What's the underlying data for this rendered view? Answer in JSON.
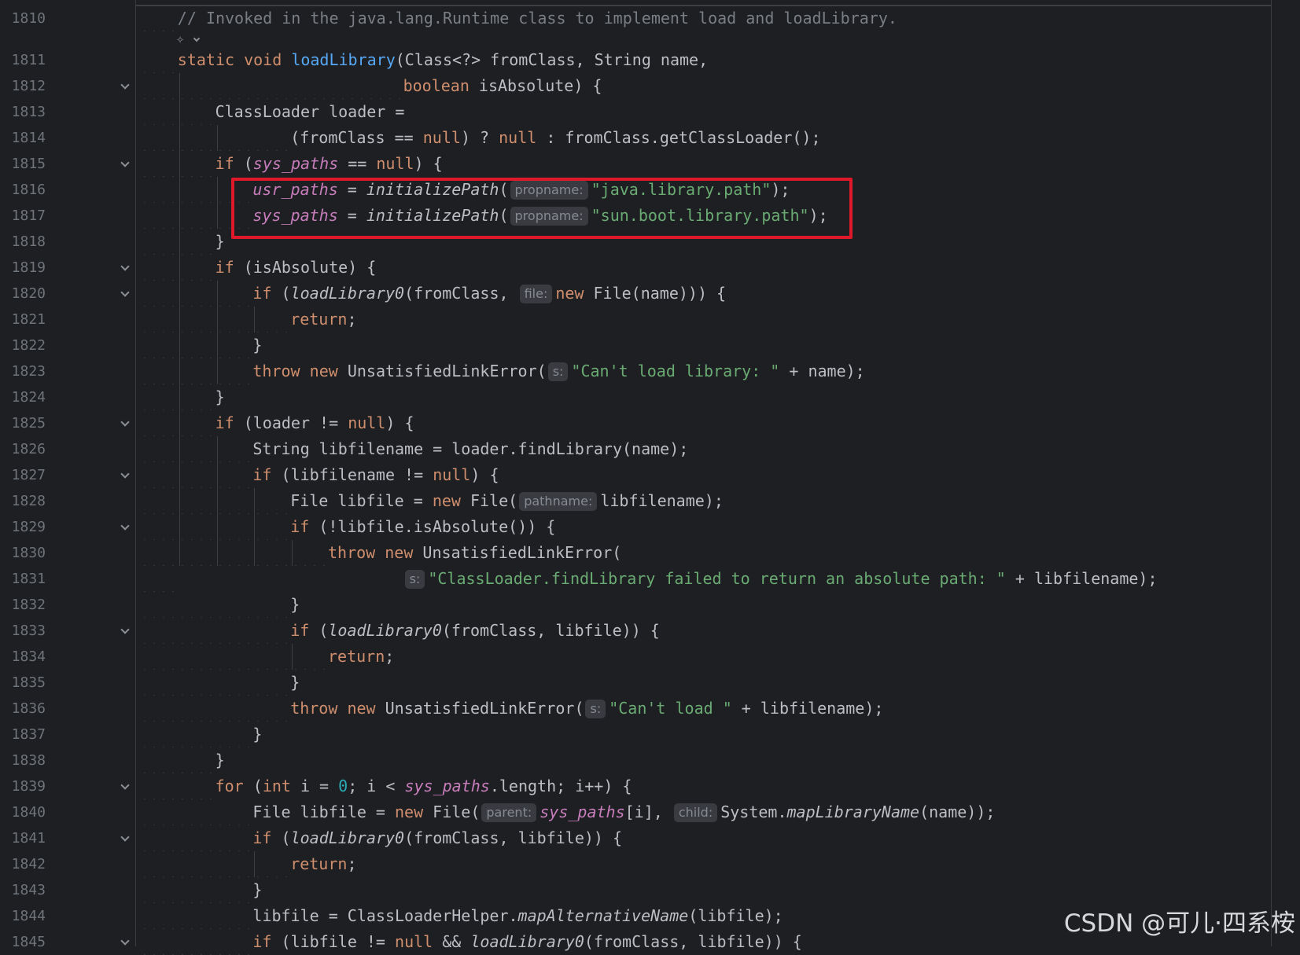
{
  "editor": {
    "ai_hint_icon": "ai-assistant-icon",
    "watermark": "CSDN @可儿·四系桉",
    "lines": [
      {
        "num": "1810",
        "indent": 4,
        "fold": false,
        "guides": [],
        "tokens": [
          [
            "comment",
            "// Invoked in the java.lang.Runtime class to implement load and loadLibrary."
          ]
        ]
      },
      {
        "num": "1811",
        "indent": 4,
        "fold": false,
        "guides": [],
        "tokens": [
          [
            "kw",
            "static"
          ],
          [
            "plain",
            " "
          ],
          [
            "kw",
            "void"
          ],
          [
            "plain",
            " "
          ],
          [
            "fn",
            "loadLibrary"
          ],
          [
            "plain",
            "(Class<?> fromClass, String name,"
          ]
        ]
      },
      {
        "num": "1812",
        "indent": 28,
        "fold": true,
        "guides": [
          4
        ],
        "tokens": [
          [
            "kw",
            "boolean"
          ],
          [
            "plain",
            " isAbsolute) {"
          ]
        ]
      },
      {
        "num": "1813",
        "indent": 8,
        "fold": false,
        "guides": [
          4
        ],
        "tokens": [
          [
            "plain",
            "ClassLoader loader ="
          ]
        ]
      },
      {
        "num": "1814",
        "indent": 16,
        "fold": false,
        "guides": [
          4,
          8
        ],
        "tokens": [
          [
            "plain",
            "(fromClass == "
          ],
          [
            "kw",
            "null"
          ],
          [
            "plain",
            ") ? "
          ],
          [
            "kw",
            "null"
          ],
          [
            "plain",
            " : fromClass.getClassLoader();"
          ]
        ]
      },
      {
        "num": "1815",
        "indent": 8,
        "fold": true,
        "guides": [
          4
        ],
        "tokens": [
          [
            "kw",
            "if"
          ],
          [
            "plain",
            " ("
          ],
          [
            "field",
            "sys_paths"
          ],
          [
            "plain",
            " == "
          ],
          [
            "kw",
            "null"
          ],
          [
            "plain",
            ") {"
          ]
        ]
      },
      {
        "num": "1816",
        "indent": 12,
        "fold": false,
        "guides": [
          4,
          8
        ],
        "tokens": [
          [
            "field",
            "usr_paths"
          ],
          [
            "plain",
            " = "
          ],
          [
            "call",
            "initializePath"
          ],
          [
            "plain",
            "("
          ],
          [
            "hint",
            "propname:"
          ],
          [
            "str",
            "\"java.library.path\""
          ],
          [
            "plain",
            ");"
          ]
        ]
      },
      {
        "num": "1817",
        "indent": 12,
        "fold": false,
        "guides": [
          4,
          8
        ],
        "tokens": [
          [
            "field",
            "sys_paths"
          ],
          [
            "plain",
            " = "
          ],
          [
            "call",
            "initializePath"
          ],
          [
            "plain",
            "("
          ],
          [
            "hint",
            "propname:"
          ],
          [
            "str",
            "\"sun.boot.library.path\""
          ],
          [
            "plain",
            ");"
          ]
        ]
      },
      {
        "num": "1818",
        "indent": 8,
        "fold": false,
        "guides": [
          4
        ],
        "tokens": [
          [
            "plain",
            "}"
          ]
        ]
      },
      {
        "num": "1819",
        "indent": 8,
        "fold": true,
        "guides": [
          4
        ],
        "tokens": [
          [
            "kw",
            "if"
          ],
          [
            "plain",
            " (isAbsolute) {"
          ]
        ]
      },
      {
        "num": "1820",
        "indent": 12,
        "fold": true,
        "guides": [
          4,
          8
        ],
        "tokens": [
          [
            "kw",
            "if"
          ],
          [
            "plain",
            " ("
          ],
          [
            "call",
            "loadLibrary0"
          ],
          [
            "plain",
            "(fromClass, "
          ],
          [
            "hint",
            "file:"
          ],
          [
            "kw",
            "new"
          ],
          [
            "plain",
            " File(name))) {"
          ]
        ]
      },
      {
        "num": "1821",
        "indent": 16,
        "fold": false,
        "guides": [
          4,
          8,
          12
        ],
        "tokens": [
          [
            "kw",
            "return"
          ],
          [
            "plain",
            ";"
          ]
        ]
      },
      {
        "num": "1822",
        "indent": 12,
        "fold": false,
        "guides": [
          4,
          8
        ],
        "tokens": [
          [
            "plain",
            "}"
          ]
        ]
      },
      {
        "num": "1823",
        "indent": 12,
        "fold": false,
        "guides": [
          4,
          8
        ],
        "tokens": [
          [
            "kw",
            "throw"
          ],
          [
            "plain",
            " "
          ],
          [
            "kw",
            "new"
          ],
          [
            "plain",
            " UnsatisfiedLinkError("
          ],
          [
            "hint",
            "s:"
          ],
          [
            "str",
            "\"Can't load library: \""
          ],
          [
            "plain",
            " + name);"
          ]
        ]
      },
      {
        "num": "1824",
        "indent": 8,
        "fold": false,
        "guides": [
          4
        ],
        "tokens": [
          [
            "plain",
            "}"
          ]
        ]
      },
      {
        "num": "1825",
        "indent": 8,
        "fold": true,
        "guides": [
          4
        ],
        "tokens": [
          [
            "kw",
            "if"
          ],
          [
            "plain",
            " (loader != "
          ],
          [
            "kw",
            "null"
          ],
          [
            "plain",
            ") {"
          ]
        ]
      },
      {
        "num": "1826",
        "indent": 12,
        "fold": false,
        "guides": [
          4,
          8
        ],
        "tokens": [
          [
            "plain",
            "String libfilename = loader.findLibrary(name);"
          ]
        ]
      },
      {
        "num": "1827",
        "indent": 12,
        "fold": true,
        "guides": [
          4,
          8
        ],
        "tokens": [
          [
            "kw",
            "if"
          ],
          [
            "plain",
            " (libfilename != "
          ],
          [
            "kw",
            "null"
          ],
          [
            "plain",
            ") {"
          ]
        ]
      },
      {
        "num": "1828",
        "indent": 16,
        "fold": false,
        "guides": [
          4,
          8,
          12
        ],
        "tokens": [
          [
            "plain",
            "File libfile = "
          ],
          [
            "kw",
            "new"
          ],
          [
            "plain",
            " File("
          ],
          [
            "hint",
            "pathname:"
          ],
          [
            "plain",
            "libfilename);"
          ]
        ]
      },
      {
        "num": "1829",
        "indent": 16,
        "fold": true,
        "guides": [
          4,
          8,
          12
        ],
        "tokens": [
          [
            "kw",
            "if"
          ],
          [
            "plain",
            " (!libfile.isAbsolute()) {"
          ]
        ]
      },
      {
        "num": "1830",
        "indent": 20,
        "fold": false,
        "guides": [
          4,
          8,
          12,
          16
        ],
        "tokens": [
          [
            "kw",
            "throw"
          ],
          [
            "plain",
            " "
          ],
          [
            "kw",
            "new"
          ],
          [
            "plain",
            " UnsatisfiedLinkError("
          ]
        ]
      },
      {
        "num": "1831",
        "indent": 28,
        "dots": 4,
        "fold": false,
        "guides": [],
        "tokens": [
          [
            "hint",
            "s:"
          ],
          [
            "str",
            "\"ClassLoader.findLibrary failed to return an absolute path: \""
          ],
          [
            "plain",
            " + libfilename);"
          ]
        ]
      },
      {
        "num": "1832",
        "indent": 16,
        "fold": false,
        "guides": [],
        "tokens": [
          [
            "plain",
            "}"
          ]
        ]
      },
      {
        "num": "1833",
        "indent": 16,
        "fold": true,
        "guides": [],
        "tokens": [
          [
            "kw",
            "if"
          ],
          [
            "plain",
            " ("
          ],
          [
            "call",
            "loadLibrary0"
          ],
          [
            "plain",
            "(fromClass, libfile)) {"
          ]
        ]
      },
      {
        "num": "1834",
        "indent": 20,
        "fold": false,
        "guides": [
          16
        ],
        "tokens": [
          [
            "kw",
            "return"
          ],
          [
            "plain",
            ";"
          ]
        ]
      },
      {
        "num": "1835",
        "indent": 16,
        "fold": false,
        "guides": [],
        "tokens": [
          [
            "plain",
            "}"
          ]
        ]
      },
      {
        "num": "1836",
        "indent": 16,
        "fold": false,
        "guides": [],
        "tokens": [
          [
            "kw",
            "throw"
          ],
          [
            "plain",
            " "
          ],
          [
            "kw",
            "new"
          ],
          [
            "plain",
            " UnsatisfiedLinkError("
          ],
          [
            "hint",
            "s:"
          ],
          [
            "str",
            "\"Can't load \""
          ],
          [
            "plain",
            " + libfilename);"
          ]
        ]
      },
      {
        "num": "1837",
        "indent": 12,
        "fold": false,
        "guides": [],
        "tokens": [
          [
            "plain",
            "}"
          ]
        ]
      },
      {
        "num": "1838",
        "indent": 8,
        "fold": false,
        "guides": [],
        "tokens": [
          [
            "plain",
            "}"
          ]
        ]
      },
      {
        "num": "1839",
        "indent": 8,
        "fold": true,
        "guides": [],
        "tokens": [
          [
            "kw",
            "for"
          ],
          [
            "plain",
            " ("
          ],
          [
            "kw",
            "int"
          ],
          [
            "plain",
            " i = "
          ],
          [
            "num",
            "0"
          ],
          [
            "plain",
            "; i < "
          ],
          [
            "field",
            "sys_paths"
          ],
          [
            "plain",
            ".length; i++) {"
          ]
        ]
      },
      {
        "num": "1840",
        "indent": 12,
        "fold": false,
        "guides": [],
        "tokens": [
          [
            "plain",
            "File libfile = "
          ],
          [
            "kw",
            "new"
          ],
          [
            "plain",
            " File("
          ],
          [
            "hint",
            "parent:"
          ],
          [
            "field",
            "sys_paths"
          ],
          [
            "plain",
            "[i], "
          ],
          [
            "hint",
            "child:"
          ],
          [
            "plain",
            "System."
          ],
          [
            "call",
            "mapLibraryName"
          ],
          [
            "plain",
            "(name));"
          ]
        ]
      },
      {
        "num": "1841",
        "indent": 12,
        "fold": true,
        "guides": [],
        "tokens": [
          [
            "kw",
            "if"
          ],
          [
            "plain",
            " ("
          ],
          [
            "call",
            "loadLibrary0"
          ],
          [
            "plain",
            "(fromClass, libfile)) {"
          ]
        ]
      },
      {
        "num": "1842",
        "indent": 16,
        "fold": false,
        "guides": [
          12
        ],
        "tokens": [
          [
            "kw",
            "return"
          ],
          [
            "plain",
            ";"
          ]
        ]
      },
      {
        "num": "1843",
        "indent": 12,
        "fold": false,
        "guides": [],
        "tokens": [
          [
            "plain",
            "}"
          ]
        ]
      },
      {
        "num": "1844",
        "indent": 12,
        "fold": false,
        "guides": [],
        "tokens": [
          [
            "plain",
            "libfile = ClassLoaderHelper."
          ],
          [
            "call",
            "mapAlternativeName"
          ],
          [
            "plain",
            "(libfile);"
          ]
        ]
      },
      {
        "num": "1845",
        "indent": 12,
        "fold": true,
        "guides": [],
        "tokens": [
          [
            "kw",
            "if"
          ],
          [
            "plain",
            " (libfile != "
          ],
          [
            "kw",
            "null"
          ],
          [
            "plain",
            " && "
          ],
          [
            "call",
            "loadLibrary0"
          ],
          [
            "plain",
            "(fromClass, libfile)) {"
          ]
        ]
      }
    ]
  }
}
